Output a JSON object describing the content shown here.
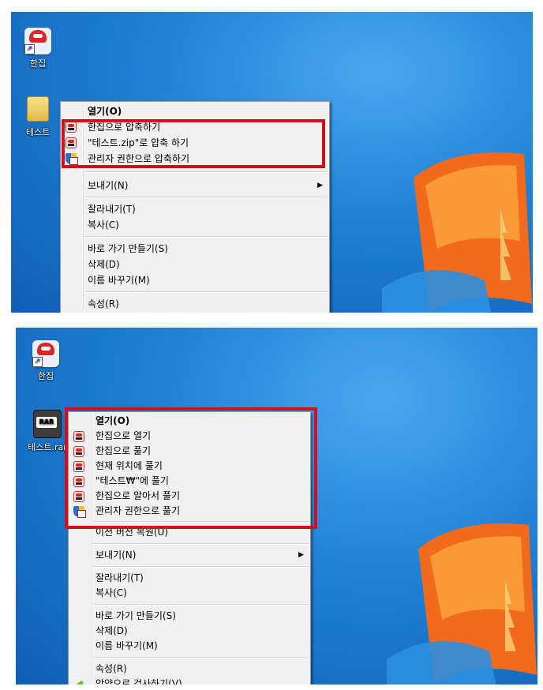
{
  "top": {
    "desktop_icons": [
      {
        "label": "한집"
      },
      {
        "label": "테스트"
      }
    ],
    "menu": {
      "items": [
        {
          "label": "열기(O)",
          "bold": true
        },
        {
          "label": "한집으로 압축하기",
          "icon": "hanzip-icon"
        },
        {
          "label": "\"테스트.zip\"로 압축 하기",
          "icon": "hanzip-icon"
        },
        {
          "label": "관리자 권한으로 압축하기",
          "icon": "shield-icon"
        },
        {
          "label": "보내기(N)",
          "submenu": true
        },
        {
          "label": "잘라내기(T)"
        },
        {
          "label": "복사(C)"
        },
        {
          "label": "바로 가기 만들기(S)"
        },
        {
          "label": "삭제(D)"
        },
        {
          "label": "이름 바꾸기(M)"
        },
        {
          "label": "속성(R)"
        }
      ],
      "submenu_arrow": "▶"
    }
  },
  "bottom": {
    "desktop_icons": [
      {
        "label": "한집"
      },
      {
        "label": "테스트.rar",
        "icon_text": "RAR"
      }
    ],
    "menu": {
      "items": [
        {
          "label": "열기(O)",
          "bold": true
        },
        {
          "label": "한집으로 열기",
          "icon": "hanzip-icon"
        },
        {
          "label": "한집으로 풀기",
          "icon": "hanzip-icon"
        },
        {
          "label": "현재 위치에 풀기",
          "icon": "hanzip-icon"
        },
        {
          "label": "\"테스트₩\"에 풀기",
          "icon": "hanzip-icon"
        },
        {
          "label": "한집으로 알아서 풀기",
          "icon": "hanzip-icon"
        },
        {
          "label": "관리자 권한으로 풀기",
          "icon": "shield-icon"
        },
        {
          "label": "이전 버전 복원(U)"
        },
        {
          "label": "보내기(N)",
          "submenu": true
        },
        {
          "label": "잘라내기(T)"
        },
        {
          "label": "복사(C)"
        },
        {
          "label": "바로 가기 만들기(S)"
        },
        {
          "label": "삭제(D)"
        },
        {
          "label": "이름 바꾸기(M)"
        },
        {
          "label": "속성(R)"
        },
        {
          "label": "악양으로 검사하기(V)",
          "icon": "scan-icon"
        }
      ],
      "submenu_arrow": "▶"
    }
  },
  "colors": {
    "highlight": "#d0101c",
    "desktop": "#1f7fd4"
  }
}
